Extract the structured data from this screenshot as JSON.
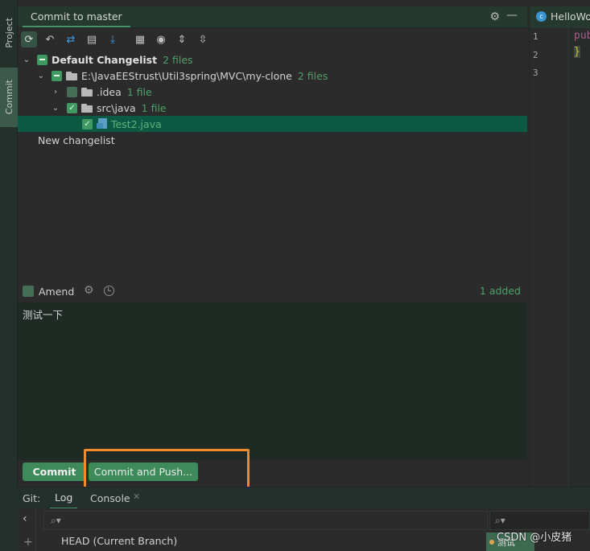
{
  "window": {
    "panel_title": "Commit to master",
    "editor_tab": "HelloWo"
  },
  "sidebar": {
    "tabs": [
      {
        "label": "Project"
      },
      {
        "label": "Commit"
      }
    ]
  },
  "tree": {
    "changelist": {
      "name": "Default Changelist",
      "count": "2 files"
    },
    "root": {
      "name": "E:\\JavaEEStrust\\Util3spring\\MVC\\my-clone",
      "count": "2 files"
    },
    "idea": {
      "name": ".idea",
      "count": "1 file"
    },
    "src": {
      "name": "src\\java",
      "count": "1 file"
    },
    "file": {
      "name": "Test2.java"
    },
    "new_changelist": "New changelist"
  },
  "amend": {
    "label": "Amend",
    "status": "1 added"
  },
  "message": {
    "text": "测试一下"
  },
  "buttons": {
    "commit": "Commit",
    "commit_and_push": "Commit and Push..."
  },
  "editor": {
    "line_numbers": [
      "1",
      "2",
      "3"
    ],
    "code_line1": "pub",
    "code_line2": "}"
  },
  "git": {
    "label": "Git:",
    "tabs": [
      {
        "label": "Log"
      },
      {
        "label": "Console"
      }
    ],
    "head_label": "HEAD (Current Branch)",
    "branch_badge": "测试"
  },
  "watermark": "CSDN @小皮猪",
  "colors": {
    "accent": "#3e8a5a",
    "highlight": "#f38a29",
    "added_text": "#4fa068"
  }
}
